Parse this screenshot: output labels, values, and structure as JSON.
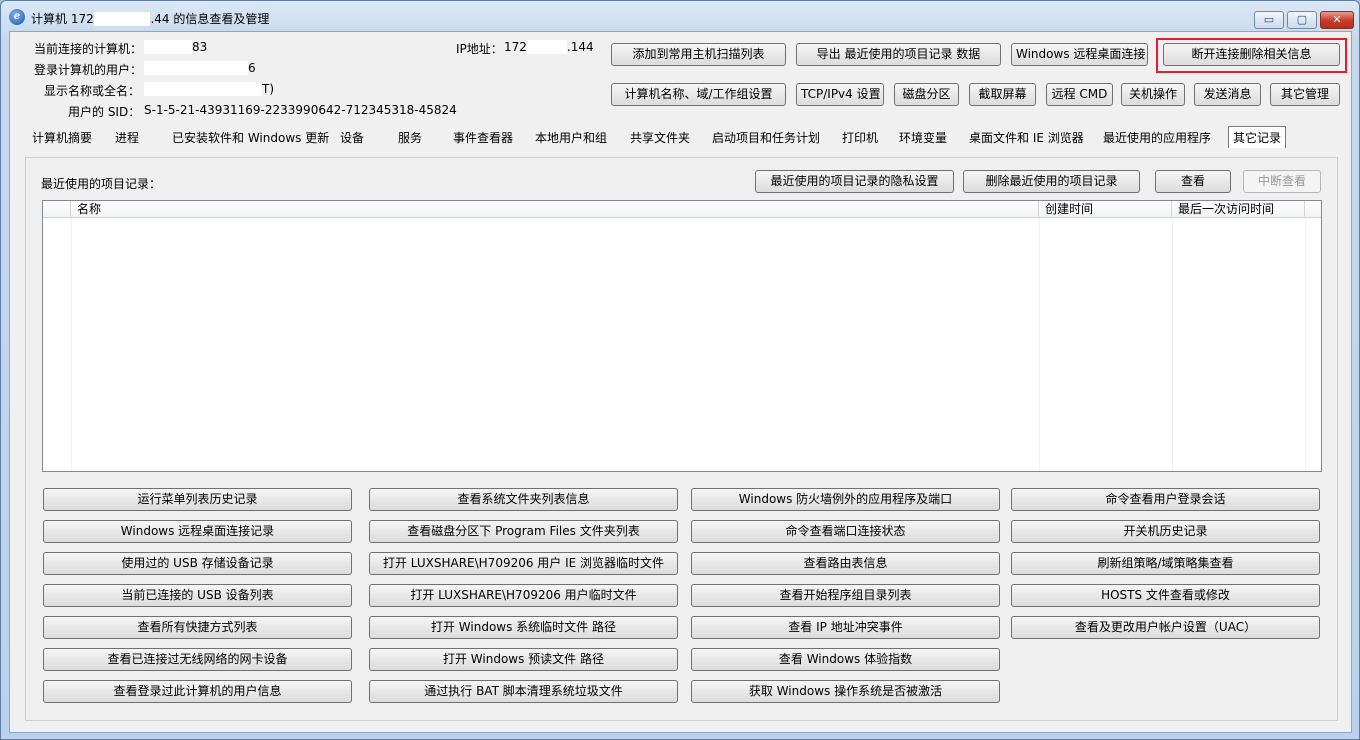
{
  "window": {
    "title_prefix": "计算机 172",
    "title_mask": "■■■■■",
    "title_suffix": ".44 的信息查看及管理",
    "minimize": "▭",
    "maximize": "▢",
    "close": "✕"
  },
  "info": {
    "computer_label": "当前连接的计算机：",
    "computer_value": "83",
    "user_label": "登录计算机的用户：",
    "user_value": "6",
    "display_label": "显示名称或全名：",
    "display_value": "T)",
    "sid_label": "用户的 SID：",
    "sid_value": "S-1-5-21-43931169-2233990642-712345318-45824",
    "ip_label": "IP地址：",
    "ip_value_prefix": "172",
    "ip_value_suffix": ".144"
  },
  "toolbar": {
    "row1": [
      "添加到常用主机扫描列表",
      "导出 最近使用的项目记录 数据",
      "Windows 远程桌面连接",
      "断开连接删除相关信息"
    ],
    "row2": [
      "计算机名称、域/工作组设置",
      "TCP/IPv4 设置",
      "磁盘分区",
      "截取屏幕",
      "远程 CMD",
      "关机操作",
      "发送消息",
      "其它管理"
    ]
  },
  "tabs": [
    "计算机摘要",
    "进程",
    "已安装软件和 Windows 更新",
    "设备",
    "服务",
    "事件查看器",
    "本地用户和组",
    "共享文件夹",
    "启动项目和任务计划",
    "打印机",
    "环境变量",
    "桌面文件和 IE 浏览器",
    "最近使用的应用程序",
    "其它记录"
  ],
  "panel": {
    "title": "最近使用的项目记录：",
    "privacy_button": "最近使用的项目记录的隐私设置",
    "delete_button": "删除最近使用的项目记录",
    "view_button": "查看",
    "stop_button": "中断查看",
    "columns": [
      "名称",
      "创建时间",
      "最后一次访问时间"
    ]
  },
  "actions": {
    "col1": [
      "运行菜单列表历史记录",
      "Windows 远程桌面连接记录",
      "使用过的 USB 存储设备记录",
      "当前已连接的 USB 设备列表",
      "查看所有快捷方式列表",
      "查看已连接过无线网络的网卡设备",
      "查看登录过此计算机的用户信息"
    ],
    "col2": [
      "查看系统文件夹列表信息",
      "查看磁盘分区下 Program Files 文件夹列表",
      "打开 LUXSHARE\\H709206 用户 IE 浏览器临时文件",
      "打开 LUXSHARE\\H709206 用户临时文件",
      "打开 Windows 系统临时文件 路径",
      "打开 Windows 预读文件 路径",
      "通过执行 BAT 脚本清理系统垃圾文件"
    ],
    "col3": [
      "Windows 防火墙例外的应用程序及端口",
      "命令查看端口连接状态",
      "查看路由表信息",
      "查看开始程序组目录列表",
      "查看 IP 地址冲突事件",
      "查看 Windows 体验指数",
      "获取 Windows 操作系统是否被激活"
    ],
    "col4": [
      "命令查看用户登录会话",
      "开关机历史记录",
      "刷新组策略/域策略集查看",
      "HOSTS 文件查看或修改",
      "查看及更改用户帐户设置（UAC）"
    ]
  },
  "colors": {
    "highlight": "#e0202c",
    "titlebar": "#c6d8ee"
  }
}
